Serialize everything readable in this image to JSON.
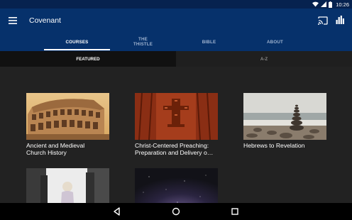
{
  "status_bar": {
    "time": "10:26",
    "icons": [
      "wifi-icon",
      "signal-icon",
      "battery-icon"
    ]
  },
  "app_bar": {
    "title": "Covenant",
    "icons": [
      "menu-icon",
      "cast-icon",
      "bar-chart-icon"
    ],
    "background": "#06316b"
  },
  "tabs": {
    "courses": "COURSES",
    "thistle_line1": "THE",
    "thistle_line2": "THISTLE",
    "bible": "BIBLE",
    "about": "ABOUT",
    "selected": "COURSES"
  },
  "sub_tabs": {
    "featured": "FEATURED",
    "az": "A-Z",
    "selected": "FEATURED"
  },
  "courses": [
    {
      "title_line1": "Ancient and Medieval",
      "title_line2": "Church History",
      "thumbnail": "colosseum-image"
    },
    {
      "title_line1": "Christ-Centered Preaching:",
      "title_line2": "Preparation and Delivery o…",
      "thumbnail": "wooden-cross-image"
    },
    {
      "title_line1": "Hebrews to Revelation",
      "title_line2": "",
      "thumbnail": "stacked-stones-image"
    },
    {
      "title_line1": "",
      "title_line2": "",
      "thumbnail": "family-walking-image"
    },
    {
      "title_line1": "",
      "title_line2": "",
      "thumbnail": "starry-sky-image"
    }
  ],
  "nav_bar": {
    "icons": [
      "back-icon",
      "home-icon",
      "recents-icon"
    ]
  }
}
